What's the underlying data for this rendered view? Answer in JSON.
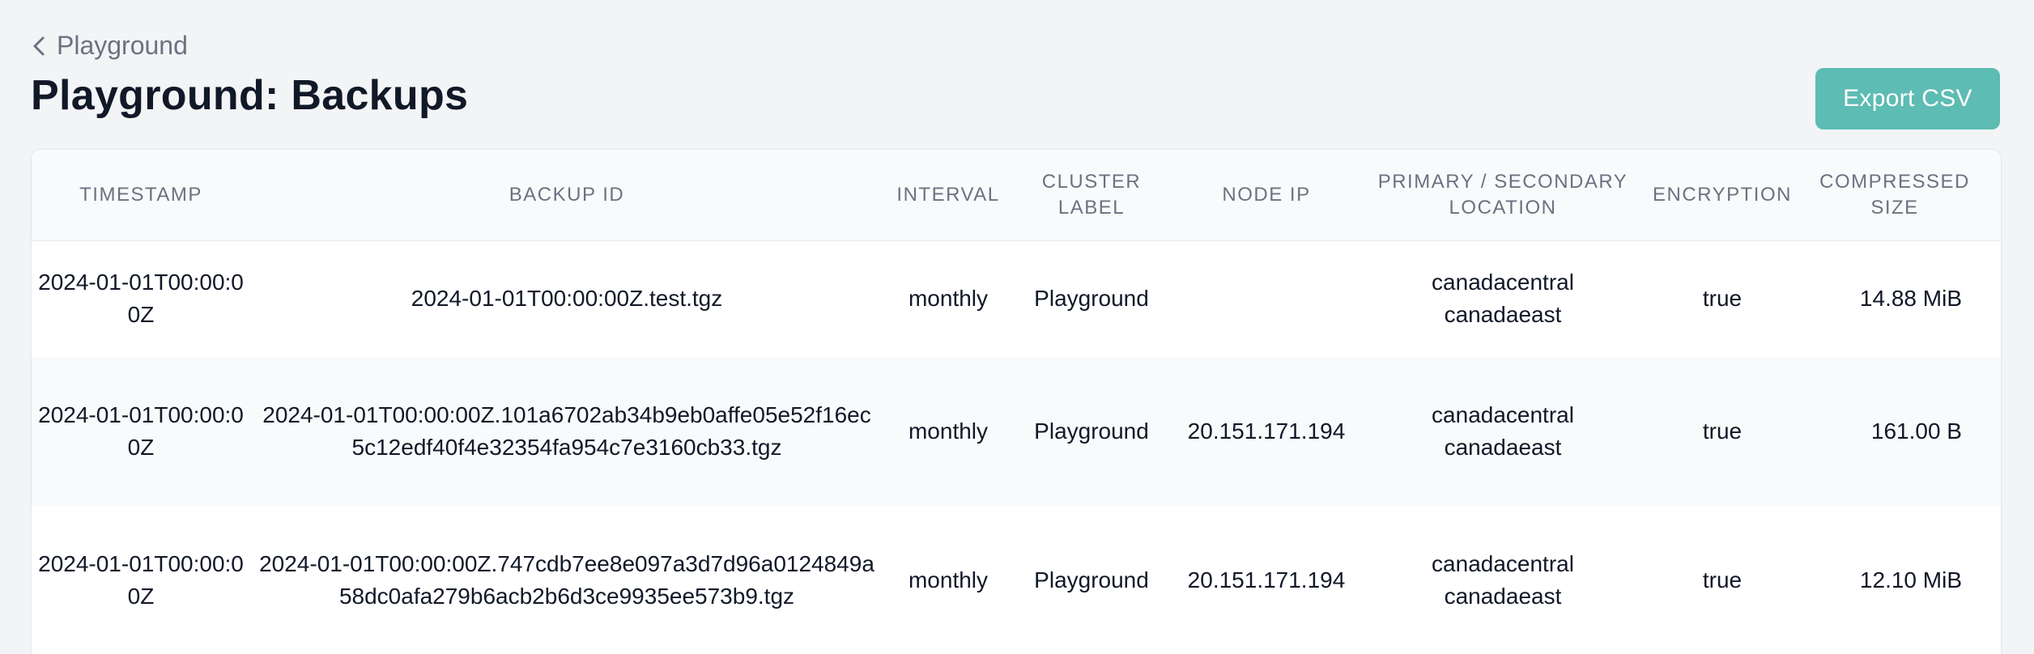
{
  "header": {
    "back_label": "Playground",
    "title": "Playground: Backups",
    "export_label": "Export CSV"
  },
  "colors": {
    "accent": "#5dbcb3",
    "background": "#f3f4f6",
    "muted_text": "#6b7280"
  },
  "table": {
    "columns": [
      {
        "label": "TIMESTAMP"
      },
      {
        "label": "BACKUP ID"
      },
      {
        "label": "INTERVAL"
      },
      {
        "label": "CLUSTER LABEL"
      },
      {
        "label": "NODE IP"
      },
      {
        "label": "PRIMARY / SECONDARY LOCATION"
      },
      {
        "label": "ENCRYPTION"
      },
      {
        "label": "COMPRESSED SIZE"
      }
    ],
    "rows": [
      {
        "timestamp": "2024-01-01T00:00:00Z",
        "backup_id": "2024-01-01T00:00:00Z.test.tgz",
        "interval": "monthly",
        "cluster_label": "Playground",
        "node_ip": "",
        "primary_location": "canadacentral",
        "secondary_location": "canadaeast",
        "encryption": "true",
        "size": "14.88 MiB"
      },
      {
        "timestamp": "2024-01-01T00:00:00Z",
        "backup_id": "2024-01-01T00:00:00Z.101a6702ab34b9eb0affe05e52f16ec5c12edf40f4e32354fa954c7e3160cb33.tgz",
        "interval": "monthly",
        "cluster_label": "Playground",
        "node_ip": "20.151.171.194",
        "primary_location": "canadacentral",
        "secondary_location": "canadaeast",
        "encryption": "true",
        "size": "161.00 B"
      },
      {
        "timestamp": "2024-01-01T00:00:00Z",
        "backup_id": "2024-01-01T00:00:00Z.747cdb7ee8e097a3d7d96a0124849a58dc0afa279b6acb2b6d3ce9935ee573b9.tgz",
        "interval": "monthly",
        "cluster_label": "Playground",
        "node_ip": "20.151.171.194",
        "primary_location": "canadacentral",
        "secondary_location": "canadaeast",
        "encryption": "true",
        "size": "12.10 MiB"
      }
    ]
  }
}
